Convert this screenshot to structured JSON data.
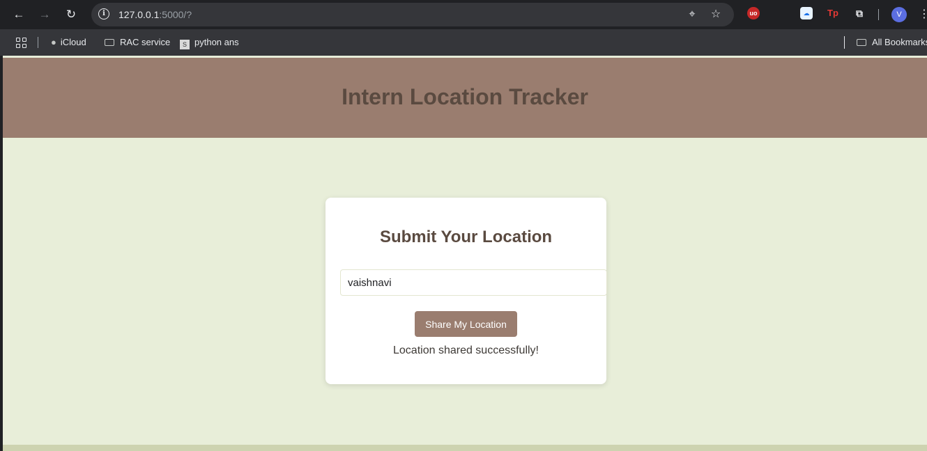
{
  "browser": {
    "url_host": "127.0.0.1",
    "url_rest": ":5000/?",
    "profile_initial": "V",
    "extensions": [
      "uBlock",
      "cloud",
      "Tp"
    ],
    "bookmarks": [
      {
        "label": "iCloud"
      },
      {
        "label": "RAC service"
      },
      {
        "label": "python ans"
      }
    ],
    "all_bookmarks_label": "All Bookmarks"
  },
  "page": {
    "title": "Intern Location Tracker",
    "form": {
      "heading": "Submit Your Location",
      "name_value": "vaishnavi",
      "button_label": "Share My Location",
      "status": "Location shared successfully!"
    }
  },
  "colors": {
    "header_bg": "#9a7d6f",
    "page_bg": "#e8eed9",
    "card_bg": "#ffffff",
    "title_text": "#5a4a40",
    "button_bg": "#9a7d6f"
  }
}
